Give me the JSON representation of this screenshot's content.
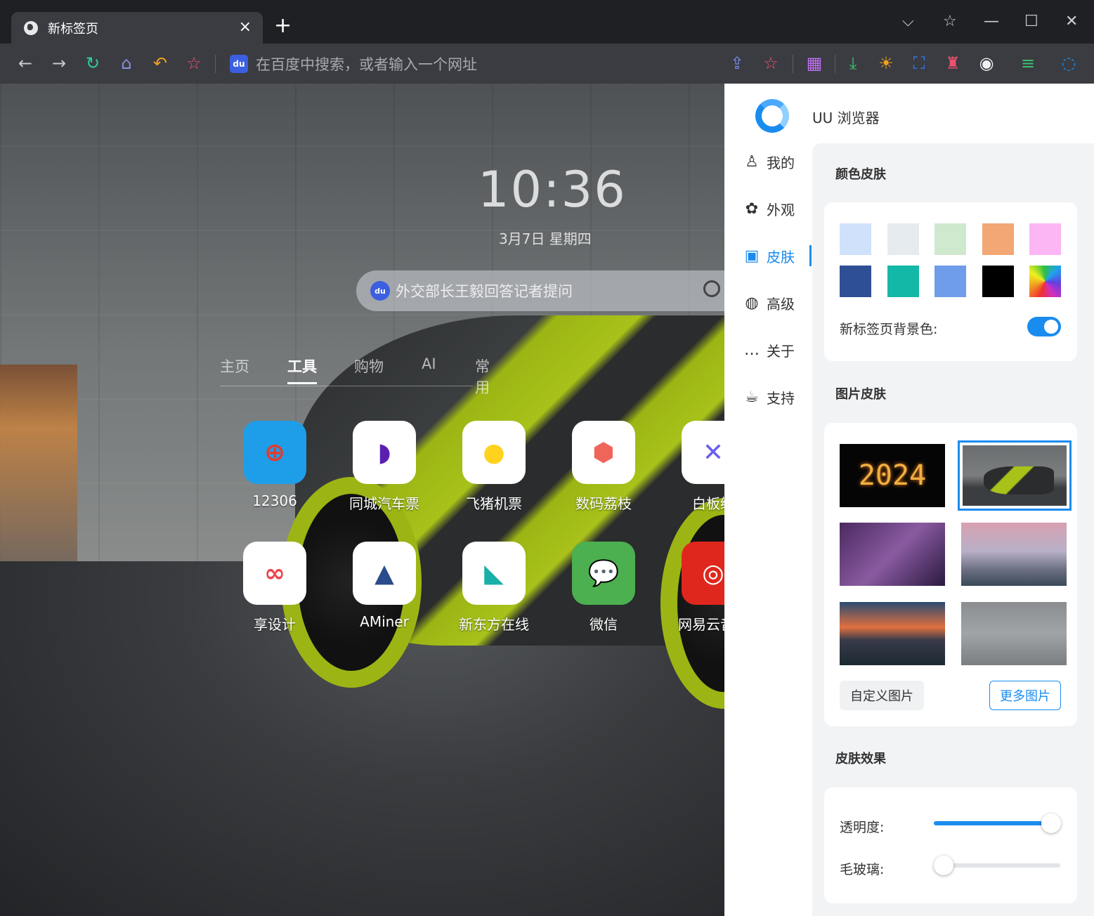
{
  "tab": {
    "title": "新标签页",
    "close": "×",
    "new": "+"
  },
  "window": {
    "dropdown": "⌵",
    "pin": "☆",
    "minimize": "—",
    "maximize": "☐",
    "close": "✕"
  },
  "address": {
    "engine_badge": "du",
    "placeholder": "在百度中搜索，或者输入一个网址"
  },
  "newtab": {
    "time": "10:36",
    "date": "3月7日 星期四",
    "search_badge": "du",
    "search_placeholder": "外交部长王毅回答记者提问",
    "tabs": [
      {
        "label": "主页"
      },
      {
        "label": "工具"
      },
      {
        "label": "购物"
      },
      {
        "label": "AI"
      },
      {
        "label": "常用"
      }
    ],
    "active_tab": "工具",
    "apps": [
      {
        "label": "12306",
        "icon": "railway-icon",
        "glyph": "⊕",
        "bg": "#1e9ee8",
        "fg": "#e23b2e"
      },
      {
        "label": "同城汽车票",
        "icon": "airship-icon",
        "glyph": "◗",
        "bg": "#ffffff",
        "fg": "#5a1fb0"
      },
      {
        "label": "飞猪机票",
        "icon": "pig-icon",
        "glyph": "●",
        "bg": "#ffffff",
        "fg": "#ffd21e"
      },
      {
        "label": "数码荔枝",
        "icon": "lychee-icon",
        "glyph": "⬢",
        "bg": "#ffffff",
        "fg": "#f0655a"
      },
      {
        "label": "白板绘",
        "icon": "whiteboard-icon",
        "glyph": "✕",
        "bg": "#ffffff",
        "fg": "#6a5cf0"
      },
      {
        "label": "享设计",
        "icon": "infinity-icon",
        "glyph": "∞",
        "bg": "#ffffff",
        "fg": "#f0464b"
      },
      {
        "label": "AMiner",
        "icon": "aminer-icon",
        "glyph": "▲",
        "bg": "#ffffff",
        "fg": "#2a4b8c"
      },
      {
        "label": "新东方在线",
        "icon": "xdf-icon",
        "glyph": "◣",
        "bg": "#ffffff",
        "fg": "#18b0a8"
      },
      {
        "label": "微信",
        "icon": "wechat-icon",
        "glyph": "💬",
        "bg": "#4caf50",
        "fg": "#ffffff"
      },
      {
        "label": "网易云音乐",
        "icon": "netease-music-icon",
        "glyph": "◎",
        "bg": "#e0271d",
        "fg": "#ffffff"
      }
    ]
  },
  "panel": {
    "brand": "UU 浏览器",
    "menu": [
      {
        "label": "我的",
        "icon": "user-icon",
        "glyph": "♙"
      },
      {
        "label": "外观",
        "icon": "palette-icon",
        "glyph": "✿"
      },
      {
        "label": "皮肤",
        "icon": "image-icon",
        "glyph": "▣"
      },
      {
        "label": "高级",
        "icon": "planet-icon",
        "glyph": "◍"
      },
      {
        "label": "关于",
        "icon": "chat-icon",
        "glyph": "…"
      },
      {
        "label": "支持",
        "icon": "cup-icon",
        "glyph": "☕"
      }
    ],
    "active_menu": "皮肤",
    "color_skin": {
      "title": "颜色皮肤",
      "swatches": [
        "#cfe1fb",
        "#e6ebef",
        "#cfe9cf",
        "#f2a774",
        "#fcb6f4",
        "#2e4f93",
        "#14b8a6",
        "#6f9ceb",
        "#000000",
        "rainbow"
      ],
      "bg_label": "新标签页背景色:",
      "bg_enabled": true
    },
    "image_skin": {
      "title": "图片皮肤",
      "thumbs": [
        {
          "name": "2024",
          "label": "2024"
        },
        {
          "name": "car",
          "selected": true
        },
        {
          "name": "girl-window"
        },
        {
          "name": "city-skyline"
        },
        {
          "name": "mountain-sunset"
        },
        {
          "name": "misty-sea"
        }
      ],
      "custom_button": "自定义图片",
      "more_button": "更多图片"
    },
    "effects": {
      "title": "皮肤效果",
      "opacity_label": "透明度:",
      "opacity": 0.93,
      "blur_label": "毛玻璃:",
      "blur": 0.0
    }
  }
}
